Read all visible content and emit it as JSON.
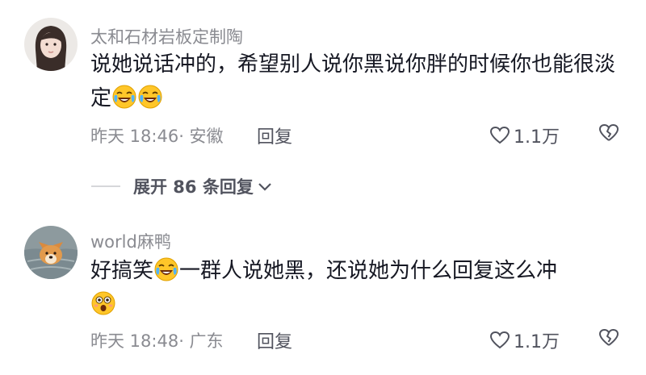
{
  "comments": [
    {
      "username": "太和石材岩板定制陶",
      "text_parts": [
        "说她说话冲的，希望别人说你黑说你胖的时候你也能很淡定"
      ],
      "emojis": [
        "laugh-cry",
        "laugh-cry"
      ],
      "meta": "昨天 18:46· 安徽",
      "reply_label": "回复",
      "likes": "1.1万",
      "avatar": "woman-portrait"
    },
    {
      "username": "world麻鸭",
      "text_before": "好搞笑",
      "text_after": "一群人说她黑，还说她为什么回复这么冲",
      "emojis": [
        "laugh-cry",
        "shocked-face"
      ],
      "meta": "昨天 18:48· 广东",
      "reply_label": "回复",
      "likes": "1.1万",
      "avatar": "dog-in-water"
    }
  ],
  "expand_replies": {
    "label": "展开 86 条回复"
  },
  "colors": {
    "text": "#161823",
    "secondary": "#8a8b91",
    "action": "#51535e",
    "emoji": "#ffc629"
  }
}
